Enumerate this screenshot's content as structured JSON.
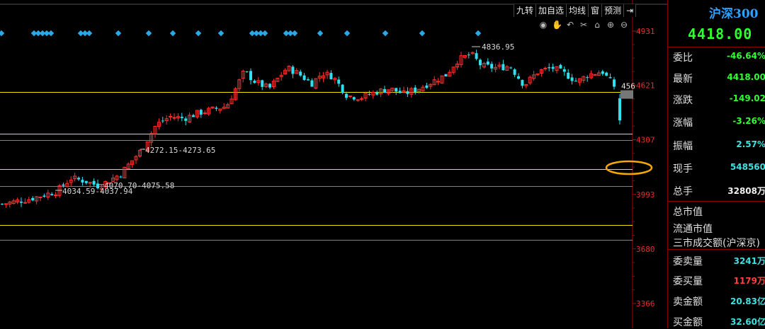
{
  "toolbar": {
    "buttons": [
      "九转",
      "加自选",
      "均线",
      "窗",
      "预测"
    ],
    "icons": [
      "eye-icon",
      "hand-icon",
      "undo-icon",
      "scissors-icon",
      "lock-icon",
      "zoom-in-icon",
      "zoom-out-icon"
    ]
  },
  "chart_data": {
    "type": "candlestick",
    "y_axis_ticks": [
      "4931",
      "4621",
      "4307",
      "3993",
      "3680",
      "3366"
    ],
    "price_tag": "456",
    "annotations": [
      {
        "label": "4836.95",
        "value": 4836.95
      },
      {
        "label": "4272.15-4273.65",
        "value": 4272.15
      },
      {
        "label": "4070.70-4075.58",
        "value": 4070.7
      },
      {
        "label": "4034.59-4037.94",
        "value": 4034.59
      }
    ],
    "horizontal_lines": [
      {
        "value": 4580,
        "color": "#e8e800"
      },
      {
        "value": 4340,
        "color": "#e8e800"
      },
      {
        "value": 4140,
        "color": "#e8e800"
      },
      {
        "value": 3818,
        "color": "#e8e800"
      },
      {
        "value": 4307,
        "color": "#808080"
      },
      {
        "value": 4040,
        "color": "#808080"
      },
      {
        "value": 3733,
        "color": "#808080"
      }
    ],
    "ylim": [
      3320,
      4960
    ],
    "markers_row": "blue diamonds along top",
    "colors": {
      "up": "#ff3030",
      "down": "#30e0f0",
      "axis": "#c00000"
    }
  },
  "side": {
    "title": "沪深300",
    "price": "4418.00",
    "rows": [
      {
        "label": "委比",
        "value": "-46.64%",
        "color": "green"
      },
      {
        "label": "最新",
        "value": "4418.00",
        "color": "green"
      },
      {
        "label": "涨跌",
        "value": "-149.02",
        "color": "green"
      },
      {
        "label": "涨幅",
        "value": "-3.26%",
        "color": "green"
      },
      {
        "label": "振幅",
        "value": "2.57%",
        "color": "cyan"
      },
      {
        "label": "现手",
        "value": "548560",
        "color": "cyan"
      },
      {
        "label": "总手",
        "value": "32808万",
        "color": "white"
      },
      {
        "label": "总市值",
        "value": "",
        "color": "white"
      },
      {
        "label": "流通市值",
        "value": "",
        "color": "white"
      },
      {
        "label": "三市成交额(沪深京)",
        "value": "",
        "color": "white"
      },
      {
        "label": "委卖量",
        "value": "3241万",
        "color": "cyan"
      },
      {
        "label": "委买量",
        "value": "1179万",
        "color": "red"
      },
      {
        "label": "卖金额",
        "value": "20.83亿",
        "color": "cyan"
      },
      {
        "label": "买金额",
        "value": "32.60亿",
        "color": "cyan"
      }
    ]
  }
}
